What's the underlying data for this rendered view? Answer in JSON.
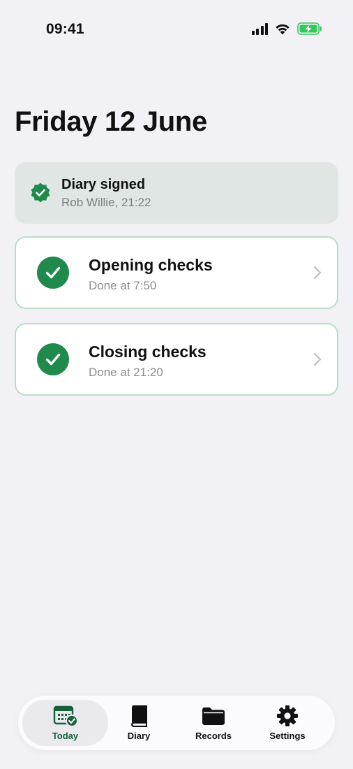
{
  "status_bar": {
    "time": "09:41"
  },
  "page": {
    "title": "Friday 12 June"
  },
  "diary_signed": {
    "title": "Diary signed",
    "subtitle": "Rob Willie, 21:22",
    "icon": "verified-badge-icon"
  },
  "checks": [
    {
      "title": "Opening checks",
      "subtitle": "Done at 7:50",
      "status": "done"
    },
    {
      "title": "Closing checks",
      "subtitle": "Done at 21:20",
      "status": "done"
    }
  ],
  "tab_bar": {
    "active": "Today",
    "tabs": [
      {
        "label": "Today",
        "icon": "calendar-check-icon"
      },
      {
        "label": "Diary",
        "icon": "book-icon"
      },
      {
        "label": "Records",
        "icon": "folder-icon"
      },
      {
        "label": "Settings",
        "icon": "gear-icon"
      }
    ]
  },
  "colors": {
    "accent": "#1f8a4c",
    "active_tab_label": "#17613a",
    "signed_card_bg": "#dfe6e3",
    "card_border": "#b9dcc6",
    "background": "#f2f1f6",
    "battery": "#34c759"
  }
}
